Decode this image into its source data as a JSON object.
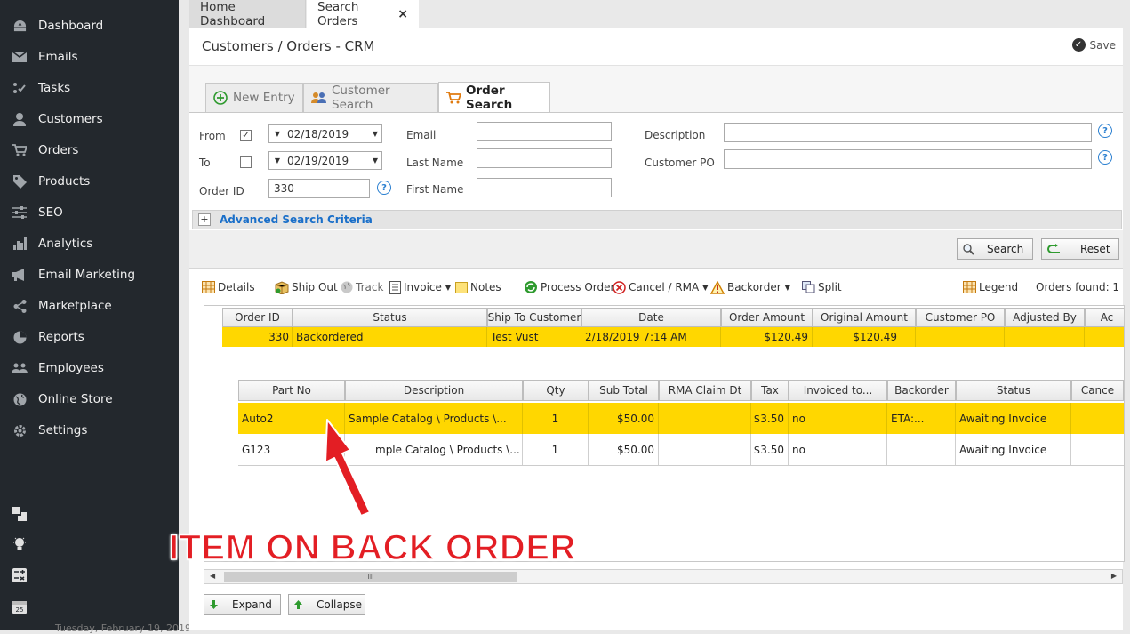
{
  "sidebar": {
    "items": [
      {
        "label": "Dashboard",
        "icon": "dashboard-icon"
      },
      {
        "label": "Emails",
        "icon": "envelope-icon"
      },
      {
        "label": "Tasks",
        "icon": "tasks-icon"
      },
      {
        "label": "Customers",
        "icon": "user-icon"
      },
      {
        "label": "Orders",
        "icon": "cart-icon"
      },
      {
        "label": "Products",
        "icon": "tag-icon"
      },
      {
        "label": "SEO",
        "icon": "sliders-icon"
      },
      {
        "label": "Analytics",
        "icon": "bar-chart-icon"
      },
      {
        "label": "Email Marketing",
        "icon": "megaphone-icon"
      },
      {
        "label": "Marketplace",
        "icon": "share-icon"
      },
      {
        "label": "Reports",
        "icon": "pie-chart-icon"
      },
      {
        "label": "Employees",
        "icon": "users-icon"
      },
      {
        "label": "Online Store",
        "icon": "globe-icon"
      },
      {
        "label": "Settings",
        "icon": "gear-icon"
      }
    ],
    "date_text": "Tuesday, February 19, 2019"
  },
  "tabs": {
    "home": "Home Dashboard",
    "active": "Search Orders",
    "close": "×"
  },
  "header": {
    "title": "Customers / Orders - CRM",
    "save": "Save"
  },
  "subtabs": {
    "new_entry": "New Entry",
    "customer_search": "Customer Search",
    "order_search": "Order Search"
  },
  "form": {
    "from_label": "From",
    "to_label": "To",
    "order_id_label": "Order ID",
    "from_checked": "✓",
    "from_date": "02/18/2019",
    "to_date": "02/19/2019",
    "order_id": "330",
    "email_label": "Email",
    "last_name_label": "Last Name",
    "first_name_label": "First Name",
    "description_label": "Description",
    "customer_po_label": "Customer PO",
    "help": "?"
  },
  "advanced": {
    "plus": "+",
    "label": "Advanced Search Criteria"
  },
  "buttons": {
    "search": "Search",
    "reset": "Reset",
    "expand": "Expand",
    "collapse": "Collapse"
  },
  "toolbar": {
    "details": "Details",
    "ship_out": "Ship Out",
    "track": "Track",
    "invoice": "Invoice",
    "notes": "Notes",
    "process_order": "Process Order",
    "cancel_rma": "Cancel / RMA",
    "backorder": "Backorder",
    "split": "Split",
    "legend": "Legend",
    "orders_found": "Orders found: 1"
  },
  "orders_table": {
    "headers": [
      "Order ID",
      "Status",
      "Ship To Customer",
      "Date",
      "Order Amount",
      "Original Amount",
      "Customer PO",
      "Adjusted By",
      "Ac"
    ],
    "row": [
      "330",
      "Backordered",
      "Test Vust",
      "2/18/2019 7:14 AM",
      "$120.49",
      "$120.49",
      "",
      "",
      ""
    ]
  },
  "items_table": {
    "headers": [
      "Part No",
      "Description",
      "Qty",
      "Sub Total",
      "RMA Claim Dt",
      "Tax",
      "Invoiced to...",
      "Backorder",
      "Status",
      "Cance"
    ],
    "rows": [
      [
        "Auto2",
        "Sample Catalog \\ Products \\...",
        "1",
        "$50.00",
        "",
        "$3.50",
        "no",
        "ETA:...",
        "Awaiting Invoice",
        ""
      ],
      [
        "G123",
        "mple Catalog \\ Products \\...",
        "1",
        "$50.00",
        "",
        "$3.50",
        "no",
        "",
        "Awaiting Invoice",
        ""
      ]
    ]
  },
  "scrollbar": {
    "grip": "III",
    "left": "◀",
    "right": "▶"
  },
  "annotation": {
    "text": "ITEM ON BACK ORDER"
  }
}
